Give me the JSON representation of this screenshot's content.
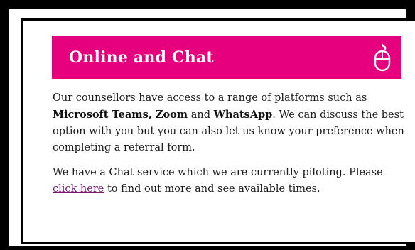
{
  "colors": {
    "banner_bg": "#e6007e",
    "banner_text": "#ffffff",
    "link": "#7a1a6e",
    "frame": "#000000"
  },
  "banner": {
    "title": "Online and Chat",
    "icon": "computer-mouse-icon"
  },
  "paragraph1": {
    "text_a": "Our counsellors have access to a range of platforms such as ",
    "bold_platforms": "Microsoft Teams, Zoom",
    "text_b": " and ",
    "bold_whatsapp": "WhatsApp",
    "text_c": ". We can discuss the best option with you but you can also let us know your preference when completing a referral form."
  },
  "paragraph2": {
    "text_a": "We have a Chat service which we are currently piloting. Please ",
    "link_label": "click here",
    "text_b": " to find out more and see available times."
  }
}
